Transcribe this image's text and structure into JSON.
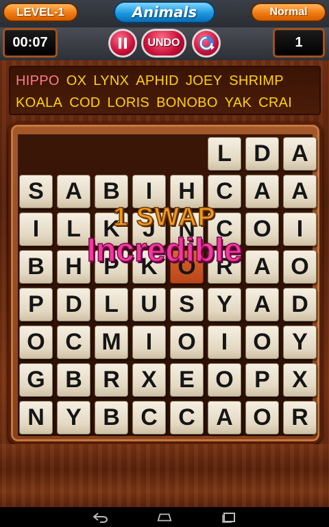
{
  "header": {
    "level": "LEVEL-1",
    "title": "Animals",
    "mode": "Normal"
  },
  "controls": {
    "timer": "00:07",
    "pause_icon": "pause-icon",
    "undo_label": "UNDO",
    "rotate_icon": "rotate-icon",
    "score": "1"
  },
  "words": {
    "row1": [
      {
        "text": "HIPPO",
        "found": true
      },
      {
        "text": "OX",
        "found": false
      },
      {
        "text": "LYNX",
        "found": false
      },
      {
        "text": "APHID",
        "found": false
      },
      {
        "text": "JOEY",
        "found": false
      },
      {
        "text": "SHRIMP",
        "found": false
      }
    ],
    "row2": [
      {
        "text": "KOALA",
        "found": false
      },
      {
        "text": "COD",
        "found": false
      },
      {
        "text": "LORIS",
        "found": false
      },
      {
        "text": "BONOBO",
        "found": false
      },
      {
        "text": "YAK",
        "found": false
      },
      {
        "text": "CRAI",
        "found": false
      }
    ]
  },
  "board": {
    "rows": [
      [
        "",
        "",
        "",
        "",
        "",
        "L",
        "D",
        "A"
      ],
      [
        "S",
        "A",
        "B",
        "I",
        "H",
        "C",
        "A",
        "A"
      ],
      [
        "I",
        "L",
        "K",
        "J",
        "N",
        "C",
        "O",
        "I"
      ],
      [
        "B",
        "H",
        "P",
        "K",
        "O",
        "R",
        "A",
        "O"
      ],
      [
        "P",
        "D",
        "L",
        "U",
        "S",
        "Y",
        "A",
        "D"
      ],
      [
        "O",
        "C",
        "M",
        "I",
        "O",
        "I",
        "O",
        "Y"
      ],
      [
        "G",
        "B",
        "R",
        "X",
        "E",
        "O",
        "P",
        "X"
      ],
      [
        "N",
        "Y",
        "B",
        "C",
        "C",
        "A",
        "O",
        "R"
      ]
    ],
    "selected": [
      [
        3,
        4
      ]
    ]
  },
  "overlay": {
    "swap": "1 SWAP",
    "praise": "Incredible"
  },
  "nav": {
    "back_icon": "back-icon",
    "home_icon": "home-icon",
    "recent_icon": "recent-apps-icon"
  },
  "colors": {
    "found_word": "#ff7a88",
    "word": "#ffd400",
    "swap_text": "#f09a1c",
    "praise_text": "#f23aa0"
  }
}
